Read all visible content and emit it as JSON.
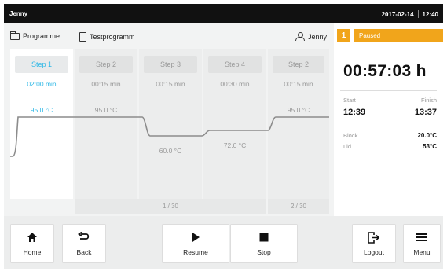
{
  "status_bar": {
    "user": "Jenny",
    "date": "2017-02-14",
    "time": "12:40"
  },
  "program_bar": {
    "programs_label": "Programme",
    "program_name": "Testprogramm",
    "user_label": "Jenny"
  },
  "steps": [
    {
      "label": "Step 1",
      "duration": "02:00 min",
      "temperature": "95.0 °C",
      "active": true
    },
    {
      "label": "Step 2",
      "duration": "00:15 min",
      "temperature": "95.0 °C",
      "active": false
    },
    {
      "label": "Step 3",
      "duration": "00:15 min",
      "temperature": "60.0 °C",
      "active": false
    },
    {
      "label": "Step 4",
      "duration": "00:30 min",
      "temperature": "72.0 °C",
      "active": false
    },
    {
      "label": "Step 2",
      "duration": "00:15 min",
      "temperature": "95.0 °C",
      "active": false
    }
  ],
  "cycles": {
    "first": "1 / 30",
    "second": "2 / 30"
  },
  "status": {
    "step_number": "1",
    "state": "Paused",
    "remaining": "00:57:03 h",
    "start_label": "Start",
    "start_time": "12:39",
    "finish_label": "Finish",
    "finish_time": "13:37",
    "block_label": "Block",
    "block_temp": "20.0°C",
    "lid_label": "Lid",
    "lid_temp": "53°C"
  },
  "toolbar": {
    "home": "Home",
    "back": "Back",
    "resume": "Resume",
    "stop": "Stop",
    "logout": "Logout",
    "menu": "Menu"
  },
  "colors": {
    "accent": "#2fb8e6",
    "paused": "#f1a51b",
    "status_bar": "#111111"
  },
  "icons": [
    "folder-icon",
    "file-icon",
    "user-icon",
    "home-icon",
    "back-icon",
    "play-icon",
    "stop-icon",
    "logout-icon",
    "menu-icon"
  ]
}
